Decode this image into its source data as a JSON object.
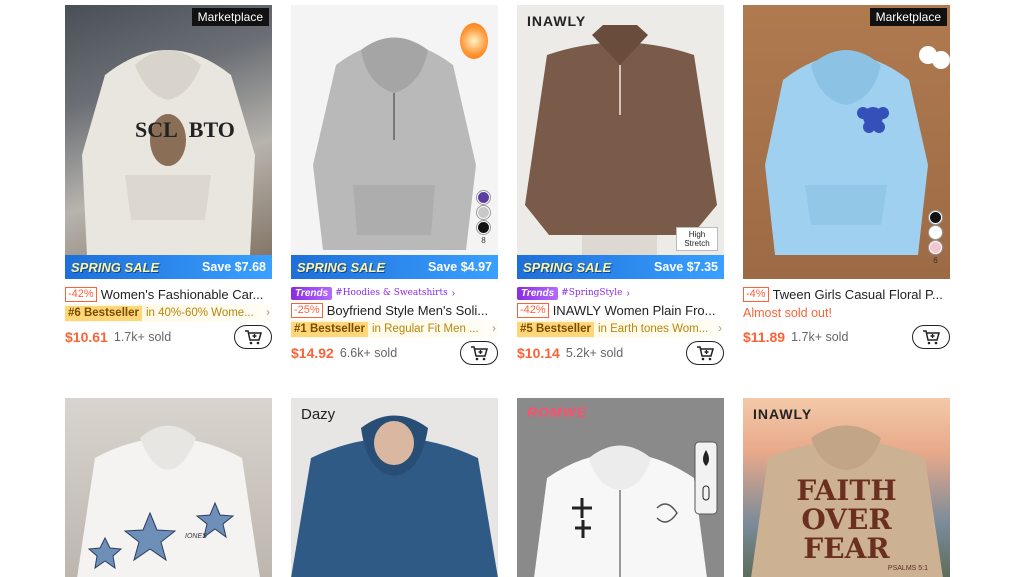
{
  "products": [
    {
      "badge": "Marketplace",
      "sale_banner": {
        "label": "SPRING SALE",
        "save": "Save $7.68"
      },
      "discount": "-42%",
      "title": "Women's Fashionable Car...",
      "bestseller": {
        "rank": "#6 Bestseller",
        "category": "in 40%-60% Wome..."
      },
      "price": "$10.61",
      "sold": "1.7k+ sold"
    },
    {
      "sale_banner": {
        "label": "SPRING SALE",
        "save": "Save $4.97"
      },
      "trend": {
        "label": "Trends",
        "topic": "#Hoodies & Sweatshirts"
      },
      "discount": "-25%",
      "title": "Boyfriend Style Men's Soli...",
      "bestseller": {
        "rank": "#1 Bestseller",
        "category": "in Regular Fit Men ..."
      },
      "price": "$14.92",
      "sold": "6.6k+ sold",
      "swatches": [
        "#5b3fa0",
        "#c8c8c8",
        "#111111"
      ],
      "swatch_more": "8"
    },
    {
      "brand": "INAWLY",
      "image_tag": "High Stretch",
      "sale_banner": {
        "label": "SPRING SALE",
        "save": "Save $7.35"
      },
      "trend": {
        "label": "Trends",
        "topic": "#SpringStyle"
      },
      "discount": "-42%",
      "title": "INAWLY Women Plain Fro...",
      "bestseller": {
        "rank": "#5 Bestseller",
        "category": "in Earth tones Wom..."
      },
      "price": "$10.14",
      "sold": "5.2k+ sold"
    },
    {
      "badge": "Marketplace",
      "discount": "-4%",
      "title": "Tween Girls Casual Floral P...",
      "status": "Almost sold out!",
      "price": "$11.89",
      "sold": "1.7k+ sold",
      "swatches": [
        "#111111",
        "#ffffff",
        "#f4c6cf"
      ],
      "swatch_more": "6"
    },
    {
      "print": "IONES"
    },
    {
      "brand": "Dazy"
    },
    {
      "brand": "ROMWE"
    },
    {
      "brand": "INAWLY",
      "print": [
        "FAITH",
        "OVER",
        "FEAR"
      ],
      "print_small": "PSALMS 5:1"
    }
  ]
}
